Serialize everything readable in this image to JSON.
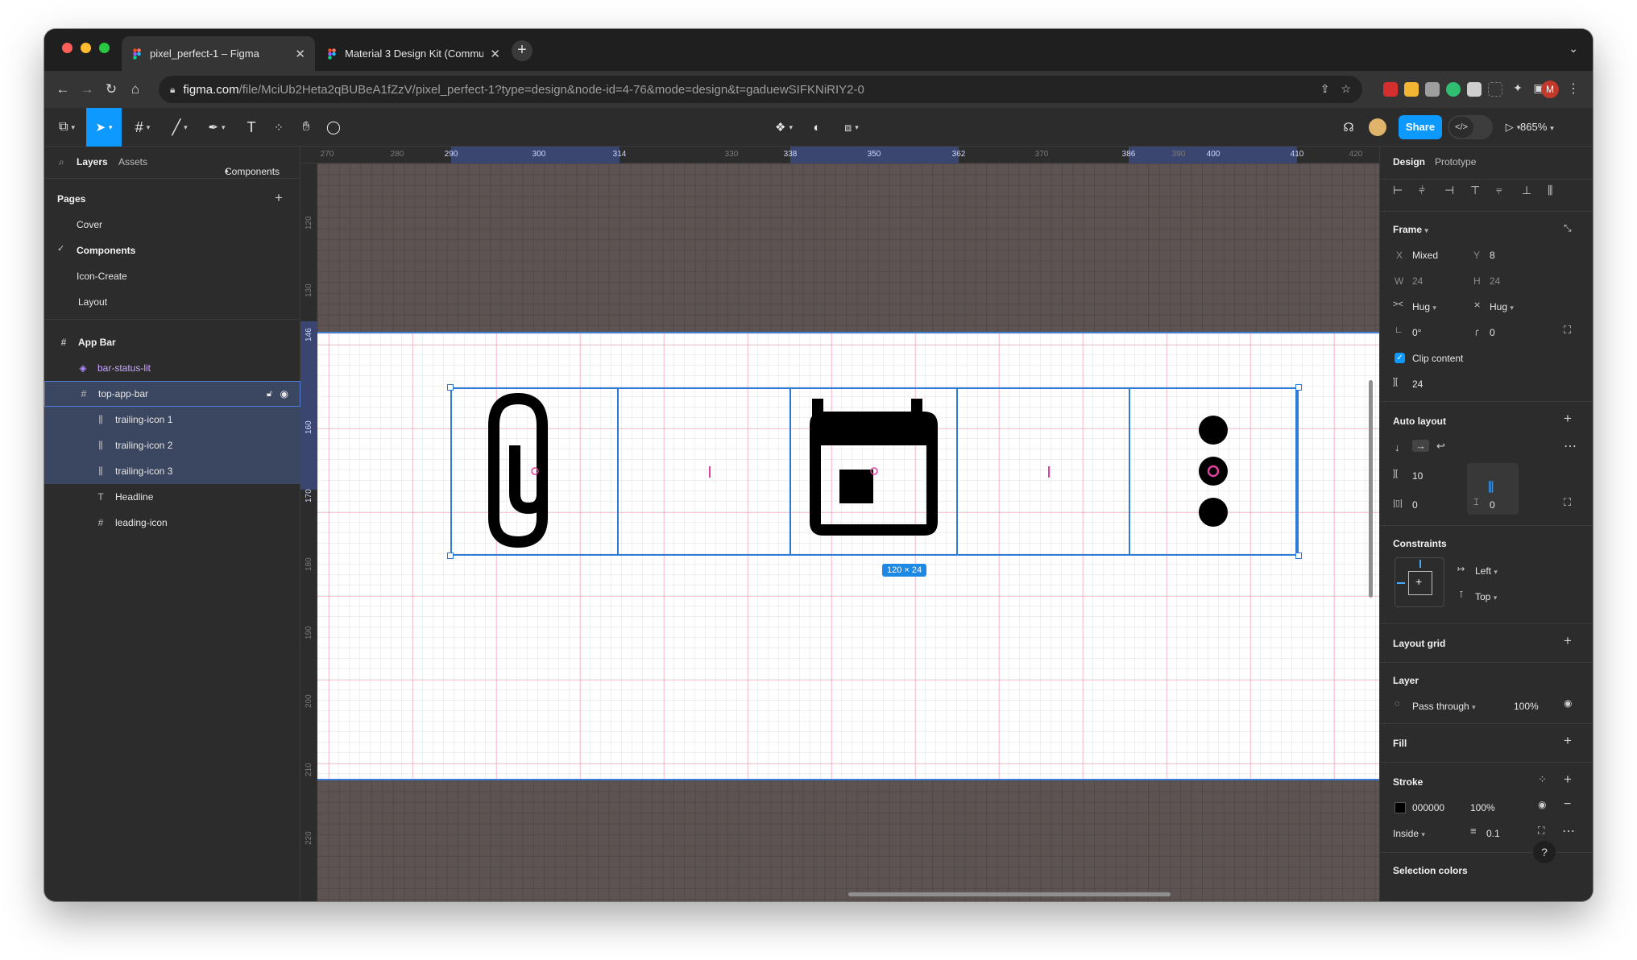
{
  "browser": {
    "tabs": [
      {
        "title": "pixel_perfect-1 – Figma",
        "active": true
      },
      {
        "title": "Material 3 Design Kit (Commu",
        "active": false
      }
    ],
    "url_host": "figma.com",
    "url_path": "/file/MciUb2Heta2qBUBeA1fZzV/pixel_perfect-1?type=design&node-id=4-76&mode=design&t=gaduewSIFKNiRIY2-0",
    "profile_initial": "M"
  },
  "toolbar": {
    "share_label": "Share",
    "zoom_label": "865%"
  },
  "left_panel": {
    "tabs": {
      "layers": "Layers",
      "assets": "Assets",
      "components": "Components"
    },
    "pages_title": "Pages",
    "pages": [
      "Cover",
      "Components",
      "Icon-Create",
      "Layout"
    ],
    "current_page": "Components",
    "layers": [
      {
        "name": "App Bar",
        "icon": "frame-icon"
      },
      {
        "name": "bar-status-lit",
        "icon": "component-instance-icon"
      },
      {
        "name": "top-app-bar",
        "icon": "frame-icon"
      },
      {
        "name": "trailing-icon 1",
        "icon": "auto-layout-icon"
      },
      {
        "name": "trailing-icon 2",
        "icon": "auto-layout-icon"
      },
      {
        "name": "trailing-icon 3",
        "icon": "auto-layout-icon"
      },
      {
        "name": "Headline",
        "icon": "text-icon"
      },
      {
        "name": "leading-icon",
        "icon": "frame-icon"
      }
    ]
  },
  "canvas": {
    "ruler_top": [
      "270",
      "280",
      "290",
      "300",
      "314",
      "330",
      "338",
      "350",
      "362",
      "370",
      "386",
      "390",
      "400",
      "410",
      "420"
    ],
    "ruler_left": [
      "120",
      "130",
      "146",
      "160",
      "170",
      "180",
      "190",
      "200",
      "210",
      "220"
    ],
    "selection_size": "120 × 24"
  },
  "right_panel": {
    "tabs": {
      "design": "Design",
      "prototype": "Prototype"
    },
    "frame": {
      "title": "Frame",
      "x_label": "X",
      "x_value": "Mixed",
      "y_label": "Y",
      "y_value": "8",
      "w_label": "W",
      "w_value": "24",
      "h_label": "H",
      "h_value": "24",
      "width_mode": "Hug",
      "height_mode": "Hug",
      "rotation": "0°",
      "radius": "0",
      "clip_content": "Clip content",
      "spacing": "24"
    },
    "auto_layout": {
      "title": "Auto layout",
      "gap": "10",
      "padding_h": "0",
      "padding_v": "0"
    },
    "constraints": {
      "title": "Constraints",
      "horizontal": "Left",
      "vertical": "Top"
    },
    "layout_grid": {
      "title": "Layout grid"
    },
    "layer": {
      "title": "Layer",
      "blend": "Pass through",
      "opacity": "100%"
    },
    "fill": {
      "title": "Fill"
    },
    "stroke": {
      "title": "Stroke",
      "color": "000000",
      "opacity": "100%",
      "position": "Inside",
      "weight": "0.1"
    },
    "selection_colors": {
      "title": "Selection colors"
    }
  },
  "colors": {
    "accent": "#0d99ff",
    "selection": "#2e7bd6",
    "canvas_bg": "#5d5352",
    "panel_bg": "#2c2c2c"
  }
}
